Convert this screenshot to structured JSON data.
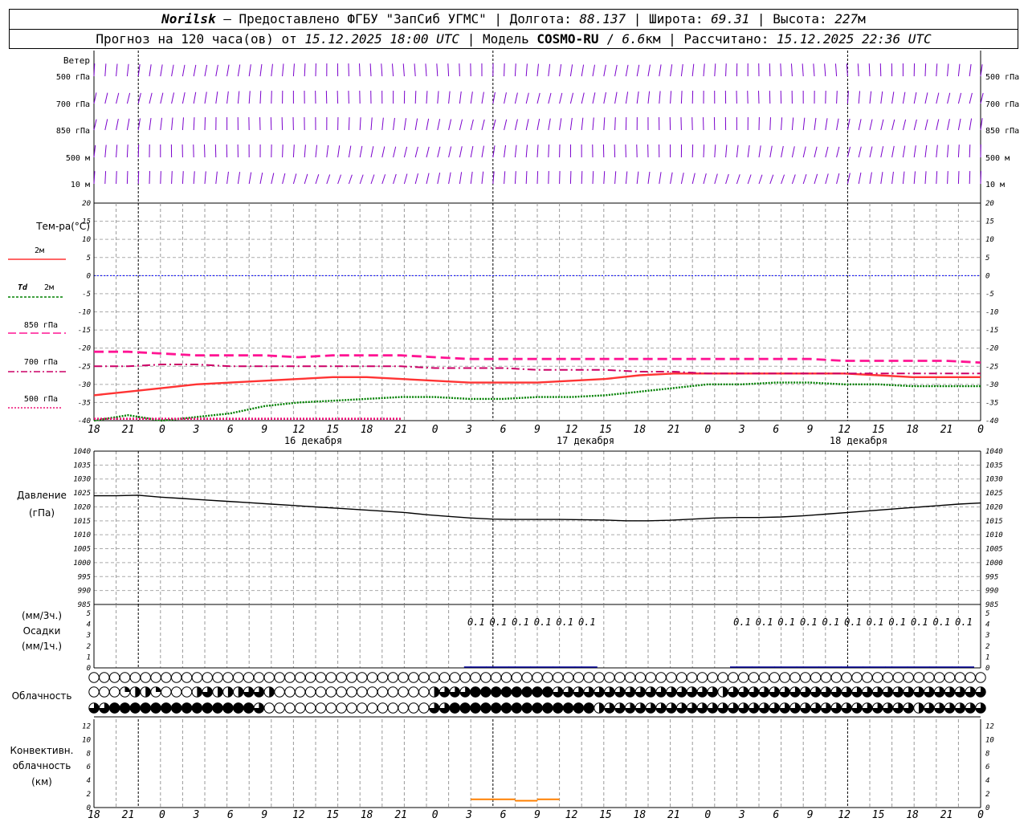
{
  "header": {
    "station": "Norilsk",
    "source": " – Предоставлено ФГБУ \"ЗапСиб УГМС\" | Долгота: ",
    "lon": "88.137",
    "lat_label": " | Широта: ",
    "lat": "69.31",
    "alt_label": " | Высота: ",
    "alt": "227",
    "alt_unit": "м",
    "fc_prefix": "Прогноз на 120 часа(ов) от ",
    "fc_time": "15.12.2025 18:00 UTC",
    "model_label": " | Модель ",
    "model": "COSMO-RU",
    "model_sep": " / ",
    "model_res": "6.6",
    "model_res_unit": "км | Рассчитано: ",
    "calc_time": "15.12.2025 22:36 UTC"
  },
  "time_axis": {
    "hours": [
      "18",
      "21",
      "0",
      "3",
      "6",
      "9",
      "12",
      "15",
      "18",
      "21",
      "0",
      "3",
      "6",
      "9",
      "12",
      "15",
      "18",
      "21",
      "0",
      "3",
      "6",
      "9",
      "12",
      "15",
      "18",
      "21",
      "0"
    ],
    "days": [
      "16 декабря",
      "17 декабря",
      "18 декабря"
    ]
  },
  "labels": {
    "wind": "Ветер",
    "levels": [
      "500 гПа",
      "700 гПа",
      "850 гПа",
      "500 м",
      "10 м"
    ],
    "temp_title": "Тем-ра(°C)",
    "legend_2m": "2м",
    "legend_td": "Td",
    "legend_td_2m": "2м",
    "legend_850": "850 гПа",
    "legend_700": "700 гПа",
    "legend_500": "500 гПа",
    "pressure_title": "Давление",
    "pressure_unit": "(гПа)",
    "precip_unit3": "(мм/3ч.)",
    "precip_title": "Осадки",
    "precip_unit1": "(мм/1ч.)",
    "cloud_title": "Облачность",
    "conv_title": "Конвективн.",
    "conv_title2": "облачность",
    "conv_unit": "(км)"
  },
  "colors": {
    "t2m": "#ff3333",
    "td": "#008000",
    "t850": "#ff1493",
    "t700": "#cc0066",
    "t500": "#ee1177",
    "wind": "#7a00cc",
    "zero": "#0000ff",
    "precip": "#000099",
    "conv": "#ff8000"
  },
  "chart_data": [
    {
      "type": "line",
      "name": "temperature",
      "x_hours": [
        0,
        3,
        6,
        9,
        12,
        15,
        18,
        21,
        24,
        27,
        30,
        33,
        36,
        39,
        42,
        45,
        48,
        51,
        54,
        57,
        60,
        63,
        66,
        69,
        72,
        75,
        78
      ],
      "ylim": [
        -40,
        20
      ],
      "ticks": [
        20,
        15,
        10,
        5,
        0,
        -5,
        -10,
        -15,
        -20,
        -25,
        -30,
        -35,
        -40
      ],
      "series": [
        {
          "key": "t2m",
          "values": [
            -33,
            -32,
            -31,
            -30,
            -29.5,
            -29,
            -28.5,
            -28,
            -28,
            -28.5,
            -29,
            -29.5,
            -29.5,
            -29.5,
            -29,
            -28.5,
            -27.5,
            -27,
            -27,
            -27,
            -27,
            -27,
            -27,
            -27.5,
            -28,
            -28,
            -28
          ]
        },
        {
          "key": "td",
          "values": [
            -40,
            -38.5,
            -40,
            -39,
            -38,
            -36,
            -35,
            -34.5,
            -34,
            -33.5,
            -33.5,
            -34,
            -34,
            -33.5,
            -33.5,
            -33,
            -32,
            -31,
            -30,
            -30,
            -29.5,
            -29.5,
            -30,
            -30,
            -30.5,
            -30.5,
            -30.5
          ]
        },
        {
          "key": "t850",
          "values": [
            -21,
            -21,
            -21.5,
            -22,
            -22,
            -22,
            -22.5,
            -22,
            -22,
            -22,
            -22.5,
            -23,
            -23,
            -23,
            -23,
            -23,
            -23,
            -23,
            -23,
            -23,
            -23,
            -23,
            -23.5,
            -23.5,
            -23.5,
            -23.5,
            -24
          ]
        },
        {
          "key": "t700",
          "values": [
            -25,
            -25,
            -24.5,
            -24.5,
            -25,
            -25,
            -25,
            -25,
            -25,
            -25,
            -25.5,
            -25.5,
            -25.5,
            -26,
            -26,
            -26,
            -26.5,
            -26.5,
            -27,
            -27,
            -27,
            -27,
            -27,
            -27,
            -27,
            -27,
            -27
          ]
        },
        {
          "key": "t500",
          "values": [
            -39.5,
            -39.5,
            -39.5,
            -39.5,
            -39.5,
            -39.5,
            -39.5,
            -39.5,
            -39.5,
            -39.5
          ]
        }
      ]
    },
    {
      "type": "line",
      "name": "pressure",
      "ylim": [
        985,
        1040
      ],
      "ticks": [
        1040,
        1035,
        1030,
        1025,
        1020,
        1015,
        1010,
        1005,
        1000,
        995,
        990,
        985
      ],
      "x_hours": [
        0,
        3,
        6,
        9,
        12,
        15,
        18,
        21,
        24,
        27,
        30,
        33,
        36,
        39,
        42,
        45,
        48,
        51,
        54,
        57,
        60,
        63,
        66,
        69,
        72,
        75,
        78,
        81,
        84,
        87,
        90,
        93,
        96,
        99,
        102,
        105,
        108,
        111,
        114,
        117,
        120
      ],
      "values": [
        1024,
        1024,
        1024.2,
        1023.5,
        1023,
        1022.5,
        1022,
        1021.5,
        1021,
        1020.5,
        1020,
        1019.5,
        1019,
        1018.5,
        1018,
        1017.2,
        1016.6,
        1016,
        1015.6,
        1015.5,
        1015.5,
        1015.5,
        1015.4,
        1015.3,
        1015,
        1015,
        1015.2,
        1015.6,
        1016,
        1016.2,
        1016.2,
        1016.4,
        1016.8,
        1017.4,
        1018,
        1018.6,
        1019.2,
        1019.8,
        1020.4,
        1021,
        1021.4
      ]
    },
    {
      "type": "bar",
      "name": "precipitation",
      "ylim": [
        0,
        5
      ],
      "ticks": [
        5,
        4,
        3,
        2,
        1,
        0
      ],
      "label_hours": [
        54,
        57,
        60,
        63,
        66,
        69,
        90,
        93,
        96,
        99,
        102,
        105,
        108,
        111,
        114,
        117,
        120
      ],
      "label_values": [
        "0.1",
        "0.1",
        "0.1",
        "0.1",
        "0.1",
        "0.1",
        "0.1",
        "0.1",
        "0.1",
        "0.1",
        "0.1",
        "0.1",
        "0.1",
        "0.1",
        "0.1",
        "0.1",
        "0.1"
      ]
    },
    {
      "type": "line",
      "name": "convective_cloud",
      "ylim": [
        0,
        13
      ],
      "ticks": [
        12,
        10,
        8,
        6,
        4,
        2,
        0
      ],
      "segments": [
        [
          [
            51,
            1.2
          ],
          [
            57,
            1.2
          ]
        ],
        [
          [
            57,
            1
          ],
          [
            60,
            1
          ]
        ],
        [
          [
            60,
            1.2
          ],
          [
            63,
            1.2
          ]
        ]
      ]
    },
    {
      "type": "table",
      "name": "cloud_cover_fraction",
      "rows": [
        {
          "level": "high",
          "values": [
            0
          ]
        },
        {
          "level": "mid",
          "values": [
            0,
            0,
            0,
            0.25,
            0.5,
            0.5,
            0.25,
            0,
            0,
            0,
            0.5,
            0.75,
            0.5,
            0.5,
            0.5,
            0.75,
            0.75,
            0.5,
            0,
            0,
            0,
            0,
            0,
            0,
            0,
            0,
            0,
            0,
            0,
            0,
            0,
            0,
            0,
            0.5,
            0.75,
            0.75,
            0.75,
            1,
            1,
            1,
            1,
            1,
            1,
            1,
            1,
            0.75,
            0.75,
            0.75,
            0.75,
            0.75,
            0.75,
            0.75,
            0.75,
            0.75,
            0.75,
            0.75,
            0.75,
            0.75,
            0.75,
            0.75,
            0.75,
            0.5,
            0.75,
            0.75,
            0.75,
            0.75,
            0.75,
            0.75,
            0.75,
            0.75,
            0.75,
            0.75,
            0.75,
            0.75,
            0.75,
            0.75,
            0.75,
            0.75,
            0.75,
            0.75,
            0.75,
            0.75,
            0.75,
            0.75,
            0.75,
            0.75,
            0.75
          ]
        },
        {
          "level": "low",
          "values": [
            0.75,
            0.75,
            1,
            1,
            1,
            1,
            1,
            1,
            1,
            1,
            1,
            1,
            1,
            1,
            1,
            1,
            0.75,
            0,
            0,
            0,
            0,
            0,
            0,
            0,
            0,
            0,
            0,
            0,
            0,
            0,
            0,
            0,
            0,
            0.75,
            0.75,
            1,
            1,
            1,
            1,
            1,
            1,
            1,
            1,
            1,
            1,
            1,
            1,
            1,
            1,
            0.5,
            0.75,
            0.75,
            0.75,
            0.75,
            0.75,
            0.75,
            0.75,
            0.75,
            0.75,
            0.75,
            0.75,
            0.75,
            0.75,
            0.75,
            0.75,
            0.75,
            0.75,
            0.75,
            0.75,
            0.75,
            0.75,
            0.75,
            0.75,
            0.75,
            0.75,
            0.75,
            0.75,
            0.75,
            0.75,
            0.75,
            0.5,
            0.75,
            0.75,
            0.75,
            0.75
          ]
        }
      ]
    }
  ]
}
